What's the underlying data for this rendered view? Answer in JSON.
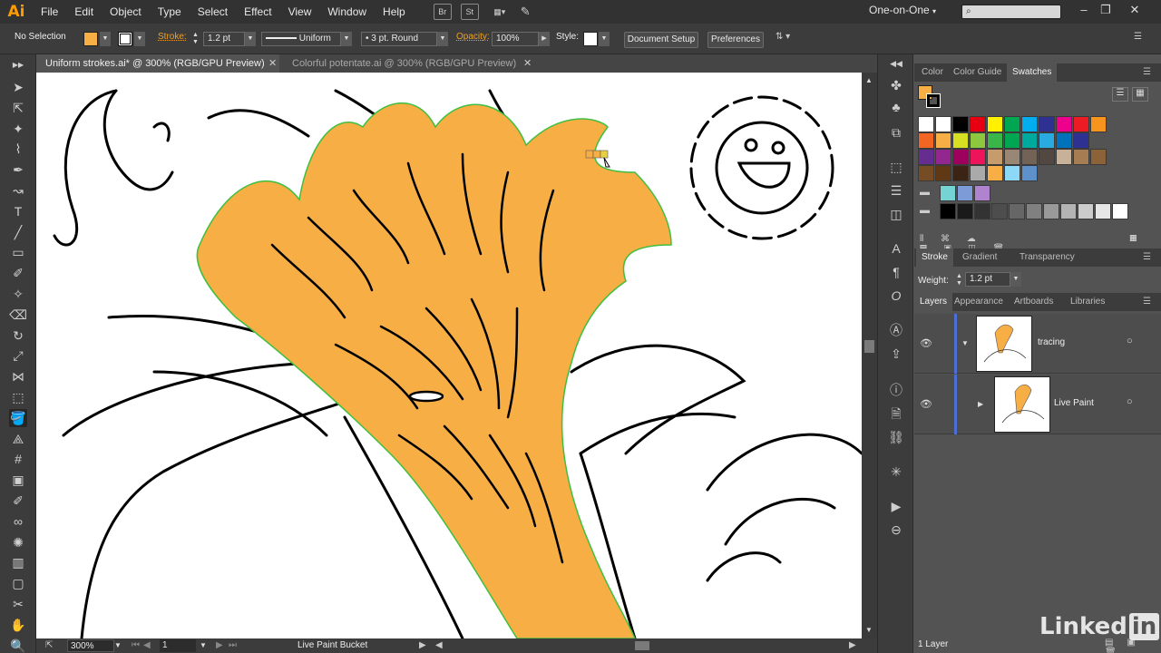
{
  "app": {
    "logo": "Ai"
  },
  "menu": [
    "File",
    "Edit",
    "Object",
    "Type",
    "Select",
    "Effect",
    "View",
    "Window",
    "Help"
  ],
  "menubar_icons": {
    "bridge": "Br",
    "stock": "St"
  },
  "workspace": {
    "label": "One-on-One"
  },
  "control": {
    "selection": "No Selection",
    "stroke_label": "Stroke:",
    "stroke_value": "1.2 pt",
    "profile": "Uniform",
    "brush": "3 pt. Round",
    "opacity_label": "Opacity:",
    "opacity_value": "100%",
    "style_label": "Style:",
    "doc_setup": "Document Setup",
    "preferences": "Preferences",
    "fill_color": "#f6ae45"
  },
  "tabs": [
    {
      "title": "Uniform strokes.ai* @ 300% (RGB/GPU Preview)"
    },
    {
      "title": "Colorful potentate.ai @ 300% (RGB/GPU Preview)"
    }
  ],
  "tools": [
    "selection-tool",
    "direct-selection-tool",
    "magic-wand-tool",
    "lasso-tool",
    "pen-tool",
    "curvature-tool",
    "type-tool",
    "line-tool",
    "rectangle-tool",
    "paintbrush-tool",
    "shaper-tool",
    "eraser-tool",
    "rotate-tool",
    "scale-tool",
    "width-tool",
    "free-transform-tool",
    "live-paint-bucket-tool",
    "perspective-tool",
    "mesh-tool",
    "gradient-tool",
    "eyedropper-tool",
    "blend-tool",
    "symbol-sprayer-tool",
    "graph-tool",
    "artboard-tool",
    "slice-tool",
    "hand-tool",
    "zoom-tool"
  ],
  "status": {
    "zoom": "300%",
    "artboard": "1",
    "tool_name": "Live Paint Bucket"
  },
  "swatches_panel": {
    "tabs": [
      "Color",
      "Color Guide",
      "Swatches"
    ],
    "active_tab": "Swatches",
    "fill_color": "#f6ae45",
    "colors_row1": [
      "#ffffff",
      "#ffffff",
      "#000000",
      "#e60012",
      "#fff100",
      "#00a651",
      "#00aeef",
      "#2e3192",
      "#ec008c",
      "#ed1c24",
      "#f7941d"
    ],
    "colors_row2": [
      "#f26522",
      "#f6ae45",
      "#d7df23",
      "#8dc63f",
      "#39b54a",
      "#00a651",
      "#00a99d",
      "#29abe2",
      "#0072bc",
      "#2e3192"
    ],
    "colors_row3": [
      "#662d91",
      "#92278f",
      "#9e005d",
      "#ed145b",
      "#c69c6d",
      "#998675",
      "#736357",
      "#534741",
      "#c7b299",
      "#a67c52",
      "#8c6239"
    ],
    "colors_row4": [
      "#754c24",
      "#603813",
      "#3c2415",
      "#aaaaaa",
      "#f6ae45",
      "#8dd7f7",
      "#5e90c9"
    ],
    "colors_row5": [
      "#75d3d3",
      "#7d9bd7",
      "#b083d1"
    ],
    "grays": [
      "#000000",
      "#1a1a1a",
      "#333333",
      "#4d4d4d",
      "#666666",
      "#808080",
      "#999999",
      "#b3b3b3",
      "#cccccc",
      "#e6e6e6",
      "#ffffff"
    ]
  },
  "stroke_panel": {
    "tabs": [
      "Stroke",
      "Gradient",
      "Transparency"
    ],
    "weight_label": "Weight:",
    "weight_value": "1.2 pt"
  },
  "layers_panel": {
    "tabs": [
      "Layers",
      "Appearance",
      "Artboards",
      "Libraries"
    ],
    "layers": [
      {
        "name": "tracing"
      },
      {
        "name": "Live Paint"
      }
    ],
    "count": "1 Layer"
  },
  "watermark": {
    "brand": "Linked",
    "suffix": "in"
  }
}
